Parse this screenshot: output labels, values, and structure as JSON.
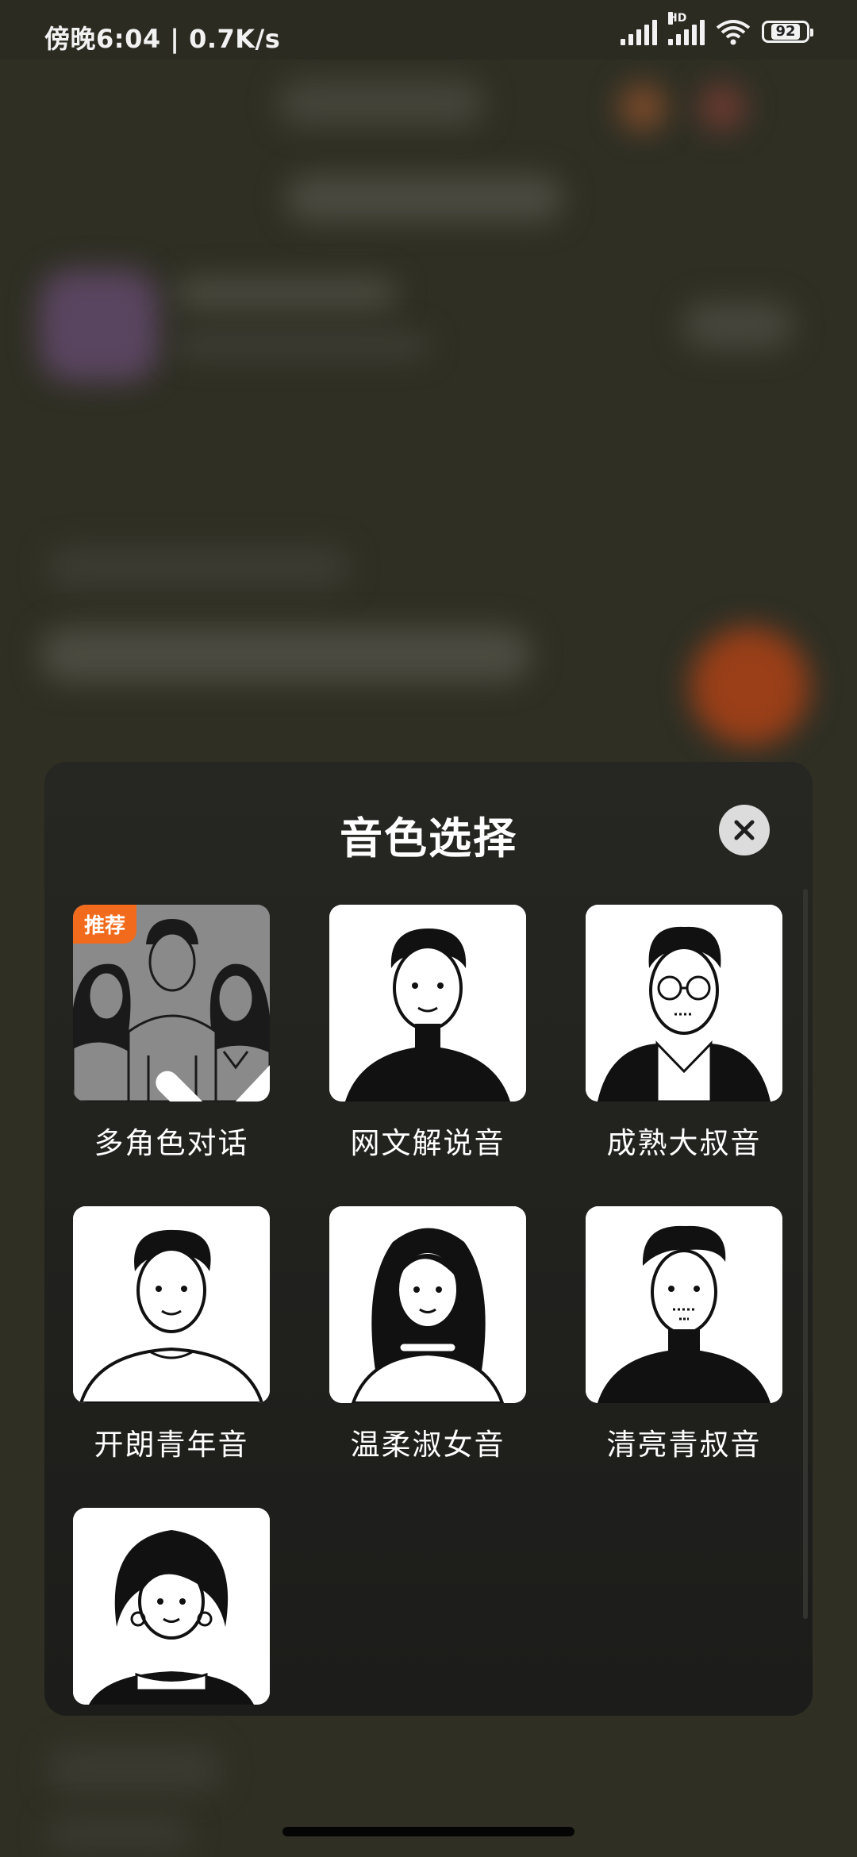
{
  "status_bar": {
    "time": "傍晚6:04 | 0.7K/s",
    "signal_tag": "HD",
    "battery": "92"
  },
  "dialog": {
    "title": "音色选择",
    "badge": "推荐",
    "voices": [
      {
        "label": "多角色对话",
        "selected": true,
        "icon": "group-avatar-icon"
      },
      {
        "label": "网文解说音",
        "selected": false,
        "icon": "young-man-avatar-icon"
      },
      {
        "label": "成熟大叔音",
        "selected": false,
        "icon": "glasses-man-avatar-icon"
      },
      {
        "label": "开朗青年音",
        "selected": false,
        "icon": "cheerful-youth-avatar-icon"
      },
      {
        "label": "温柔淑女音",
        "selected": false,
        "icon": "gentle-lady-avatar-icon"
      },
      {
        "label": "清亮青叔音",
        "selected": false,
        "icon": "uncle-avatar-icon"
      },
      {
        "label": "",
        "selected": false,
        "icon": "short-hair-woman-avatar-icon"
      }
    ]
  },
  "colors": {
    "badge": "#f26a1b",
    "sheet": "#262622",
    "backdrop": "#2f2f24"
  }
}
